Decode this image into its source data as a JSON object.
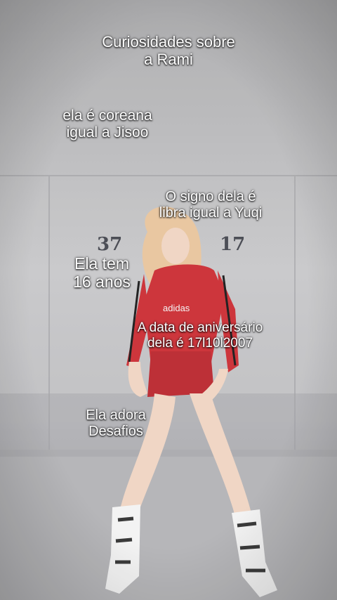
{
  "overlay": {
    "title": "Curiosidades sobre\na Rami",
    "facts": [
      "ela é coreana\nigual a Jisoo",
      "O signo dela é\nlibra igual a Yuqi",
      "Ela tem\n16 anos",
      "A data de aniversário\ndela é 17l10l2007",
      "Ela adora\nDesafios"
    ]
  },
  "photo": {
    "wall_numbers": [
      "37",
      "17"
    ],
    "jersey_text": "adidas",
    "colors": {
      "wall": "#c6c6c8",
      "floor": "#a9a9ab",
      "outfit": "#c9252c",
      "boots": "#f2f2f2",
      "hair": "#e8c39a"
    }
  }
}
